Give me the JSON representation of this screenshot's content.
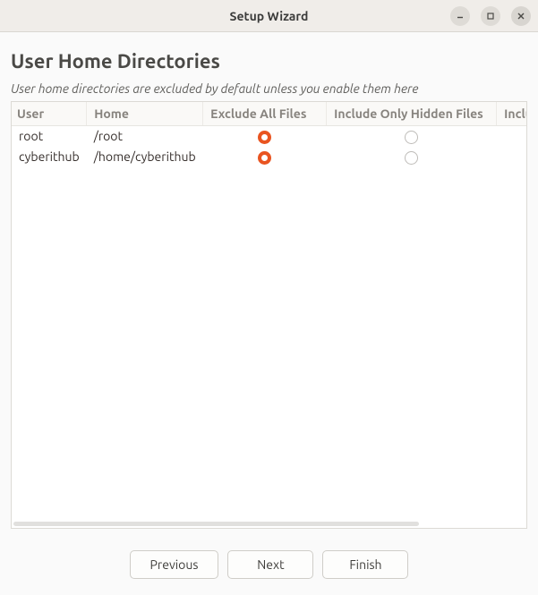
{
  "window": {
    "title": "Setup Wizard"
  },
  "page": {
    "heading": "User Home Directories",
    "subtitle": "User home directories are excluded by default unless you enable them here"
  },
  "table": {
    "columns": {
      "user": "User",
      "home": "Home",
      "exclude_all": "Exclude All Files",
      "include_hidden": "Include Only Hidden Files",
      "include_all": "Inclu"
    },
    "rows": [
      {
        "user": "root",
        "home": "/root",
        "selection": "exclude_all"
      },
      {
        "user": "cyberithub",
        "home": "/home/cyberithub",
        "selection": "exclude_all"
      }
    ]
  },
  "footer": {
    "previous": "Previous",
    "next": "Next",
    "finish": "Finish"
  },
  "icons": {
    "minimize": "minimize-icon",
    "maximize": "maximize-icon",
    "close": "close-icon"
  }
}
